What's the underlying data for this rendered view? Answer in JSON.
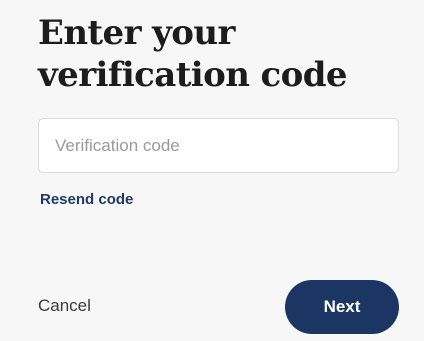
{
  "heading": {
    "line1": "Enter your",
    "line2": "verification code"
  },
  "form": {
    "code_placeholder": "Verification code",
    "code_value": "",
    "resend_label": "Resend code"
  },
  "actions": {
    "cancel_label": "Cancel",
    "next_label": "Next"
  },
  "colors": {
    "primary": "#1c3664",
    "link": "#1f3a68",
    "background": "#f7f7f7"
  }
}
